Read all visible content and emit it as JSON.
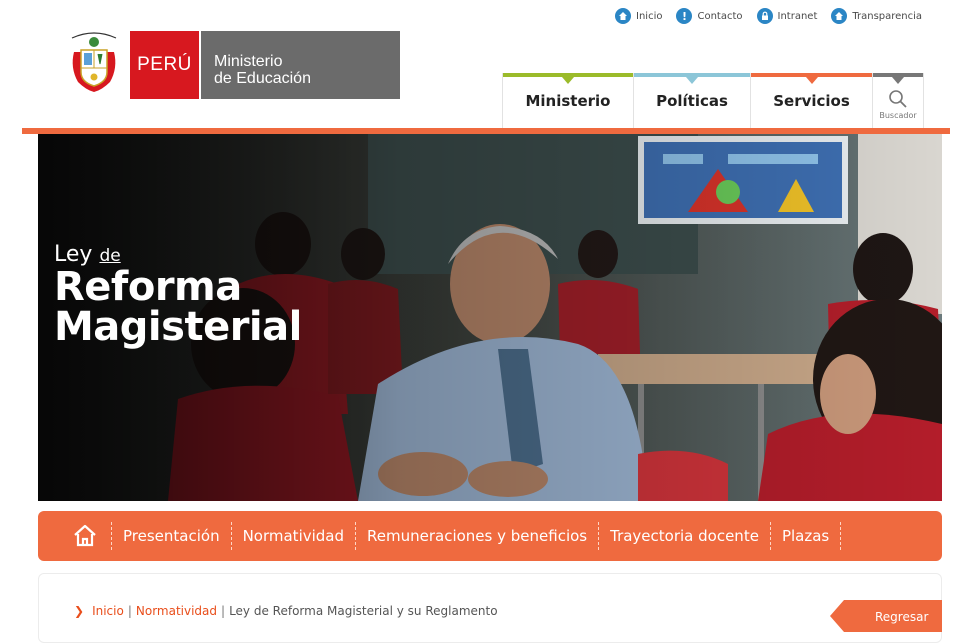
{
  "top_links": [
    {
      "label": "Inicio",
      "icon": "home-icon"
    },
    {
      "label": "Contacto",
      "icon": "alert-icon"
    },
    {
      "label": "Intranet",
      "icon": "lock-icon"
    },
    {
      "label": "Transparencia",
      "icon": "home-icon"
    }
  ],
  "logo": {
    "country": "PERÚ",
    "ministry_line1": "Ministerio",
    "ministry_line2": "de Educación"
  },
  "main_nav": [
    {
      "label": "Ministerio",
      "color": "#9bbb2a"
    },
    {
      "label": "Políticas",
      "color": "#8cc6d8"
    },
    {
      "label": "Servicios",
      "color": "#ef6a3f"
    }
  ],
  "search": {
    "label": "Buscador",
    "icon": "magnifier-icon",
    "color": "#777777"
  },
  "banner": {
    "title_line1_prefix": "Ley",
    "title_line1_suffix": "de",
    "title_line2": "Reforma",
    "title_line3": "Magisterial"
  },
  "sub_nav": {
    "home_icon": "home-outline-icon",
    "items": [
      "Presentación",
      "Normatividad",
      "Remuneraciones y beneficios",
      "Trayectoria docente",
      "Plazas"
    ]
  },
  "breadcrumb": {
    "items": [
      "Inicio",
      "Normatividad"
    ],
    "current": "Ley de Reforma Magisterial y su Reglamento"
  },
  "back_button": {
    "label": "Regresar"
  },
  "colors": {
    "accent": "#ef6a3f",
    "brand_red": "#d7181f",
    "link_blue": "#2b86c5"
  }
}
